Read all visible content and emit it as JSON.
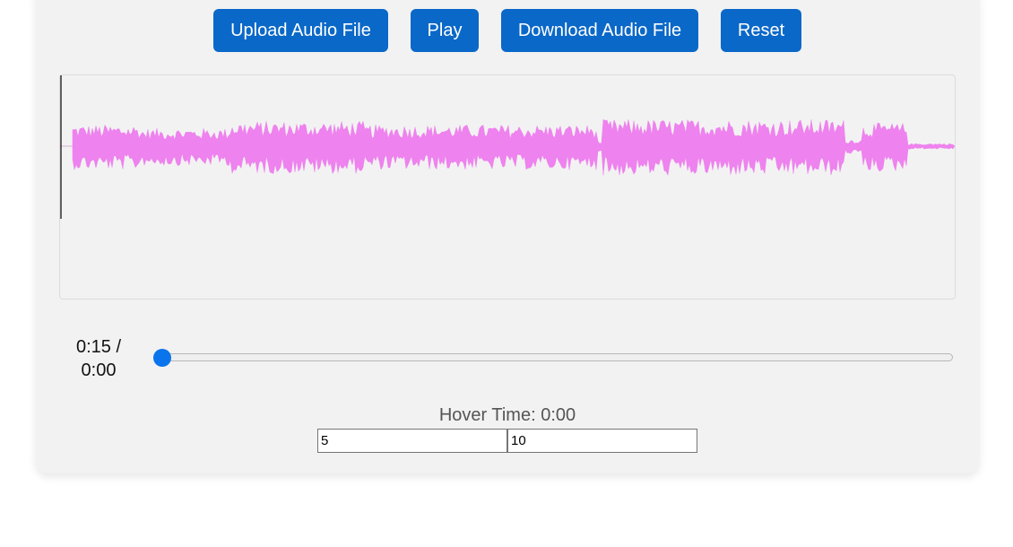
{
  "toolbar": {
    "upload_label": "Upload Audio File",
    "play_label": "Play",
    "download_label": "Download Audio File",
    "reset_label": "Reset"
  },
  "waveform": {
    "color": "#ee82ee",
    "playhead_color": "#000000",
    "playhead_progress": 0
  },
  "player": {
    "current_time": "0:15 /",
    "duration": "0:00",
    "progress": 0
  },
  "hover": {
    "label": "Hover Time: 0:00"
  },
  "range": {
    "start_value": "5",
    "end_value": "10"
  },
  "colors": {
    "accent": "#0a68c8",
    "panel_bg": "#f2f2f2",
    "slider_thumb": "#0a74ec"
  }
}
